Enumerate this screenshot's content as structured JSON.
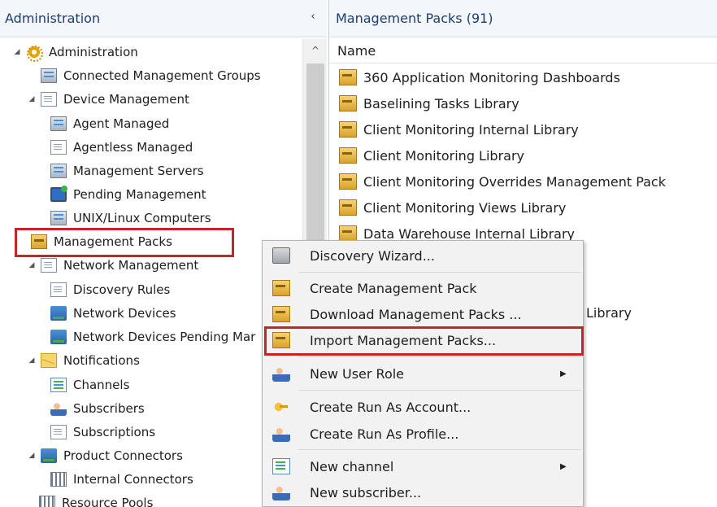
{
  "left_pane": {
    "title": "Administration",
    "collapse_glyph": "‹",
    "scroll_up_glyph": "^",
    "tree": [
      {
        "label": "Administration",
        "arrow": "◢",
        "icon": "gear-icon",
        "level": 0
      },
      {
        "label": "Connected Management Groups",
        "arrow": "",
        "icon": "server-icon",
        "level": 1
      },
      {
        "label": "Device Management",
        "arrow": "◢",
        "icon": "document-icon",
        "level": 0
      },
      {
        "label": "Agent Managed",
        "arrow": "",
        "icon": "server-icon",
        "level": 1
      },
      {
        "label": "Agentless Managed",
        "arrow": "",
        "icon": "document-icon",
        "level": 1
      },
      {
        "label": "Management Servers",
        "arrow": "",
        "icon": "server-icon",
        "level": 1
      },
      {
        "label": "Pending Management",
        "arrow": "",
        "icon": "monitor-icon",
        "level": 1
      },
      {
        "label": "UNIX/Linux Computers",
        "arrow": "",
        "icon": "server-icon",
        "level": 1
      },
      {
        "label": "Management Packs",
        "arrow": "",
        "icon": "management-pack-icon",
        "level": 0,
        "selected": true
      },
      {
        "label": "Network Management",
        "arrow": "◢",
        "icon": "document-icon",
        "level": 0
      },
      {
        "label": "Discovery Rules",
        "arrow": "",
        "icon": "document-icon",
        "level": 1
      },
      {
        "label": "Network Devices",
        "arrow": "",
        "icon": "network-icon",
        "level": 1
      },
      {
        "label": "Network Devices Pending Mar",
        "arrow": "",
        "icon": "network-icon",
        "level": 1
      },
      {
        "label": "Notifications",
        "arrow": "◢",
        "icon": "envelope-icon",
        "level": 0
      },
      {
        "label": "Channels",
        "arrow": "",
        "icon": "channel-icon",
        "level": 1
      },
      {
        "label": "Subscribers",
        "arrow": "",
        "icon": "users-icon",
        "level": 1
      },
      {
        "label": "Subscriptions",
        "arrow": "",
        "icon": "document-icon",
        "level": 1
      },
      {
        "label": "Product Connectors",
        "arrow": "◢",
        "icon": "network-icon",
        "level": 0
      },
      {
        "label": "Internal Connectors",
        "arrow": "",
        "icon": "grid-icon",
        "level": 1
      },
      {
        "label": "Resource Pools",
        "arrow": "",
        "icon": "grid-icon",
        "level": 1
      }
    ]
  },
  "right_pane": {
    "title": "Management Packs (91)",
    "column_name": "Name",
    "rows": [
      "360 Application Monitoring Dashboards",
      "Baselining Tasks Library",
      "Client Monitoring Internal Library",
      "Client Monitoring Library",
      "Client Monitoring Overrides Management Pack",
      "Client Monitoring Views Library",
      "Data Warehouse Internal Library"
    ],
    "partial_row_text": "Library"
  },
  "context_menu": {
    "items": [
      {
        "label": "Discovery Wizard...",
        "icon": "wizard-icon",
        "submenu": false
      },
      {
        "label": "Create Management Pack",
        "icon": "management-pack-icon",
        "submenu": false
      },
      {
        "label": "Download Management Packs ...",
        "icon": "management-pack-icon",
        "submenu": false
      },
      {
        "label": "Import Management Packs...",
        "icon": "management-pack-icon",
        "submenu": false,
        "highlighted": true
      },
      {
        "label": "New User Role",
        "icon": "users-icon",
        "submenu": true
      },
      {
        "label": "Create Run As Account...",
        "icon": "key-icon",
        "submenu": false
      },
      {
        "label": "Create Run As Profile...",
        "icon": "users-icon",
        "submenu": false
      },
      {
        "label": "New channel",
        "icon": "channel-icon",
        "submenu": true
      },
      {
        "label": "New subscriber...",
        "icon": "users-icon",
        "submenu": false
      }
    ],
    "submenu_glyph": "▶"
  },
  "colors": {
    "highlight_border": "#c0262c",
    "header_text": "#1b3e6e",
    "header_bg": "#f3f6fa"
  }
}
